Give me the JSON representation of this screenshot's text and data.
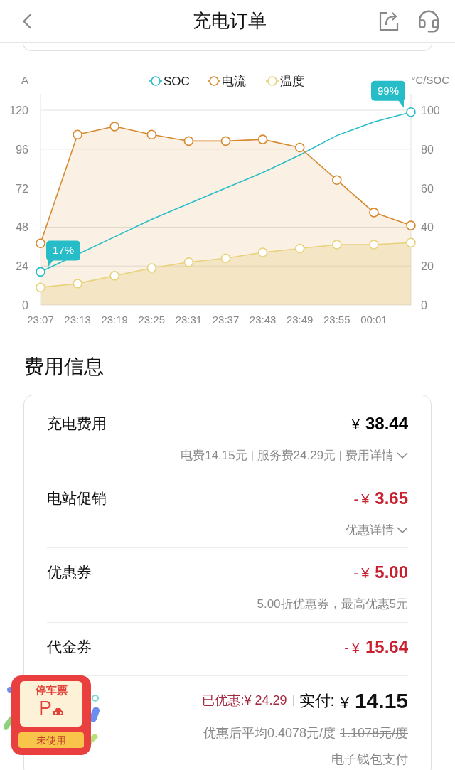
{
  "header": {
    "title": "充电订单"
  },
  "chart": {
    "chart_data": {
      "type": "line",
      "grid": true,
      "legend": "top",
      "ylabel": "A",
      "y2label": "°C/SOC",
      "ylim": [
        0,
        120
      ],
      "yticks": [
        0,
        24,
        48,
        72,
        96,
        120
      ],
      "y2lim": [
        0,
        100
      ],
      "y2ticks": [
        0,
        20,
        40,
        60,
        80,
        100
      ],
      "categories": [
        "23:07",
        "23:13",
        "23:19",
        "23:25",
        "23:31",
        "23:37",
        "23:43",
        "23:49",
        "23:55",
        "00:01",
        null
      ],
      "series": [
        {
          "name": "SOC",
          "color": "#26bdc8",
          "axis": "y2",
          "values": [
            17,
            26,
            35,
            44,
            52,
            60,
            68,
            77,
            87,
            94,
            99
          ]
        },
        {
          "name": "电流",
          "color": "#d68a30",
          "marker": "circle",
          "type": "area",
          "values": [
            38,
            105,
            110,
            105,
            101,
            101,
            102,
            97,
            77,
            57,
            49
          ]
        },
        {
          "name": "温度",
          "color": "#e8d27a",
          "axis": "y2",
          "marker": "circle",
          "type": "area",
          "values": [
            9,
            11,
            15,
            19,
            22,
            24,
            27,
            29,
            31,
            31,
            32
          ]
        }
      ],
      "annotations": [
        "17%",
        "99%"
      ]
    }
  },
  "fees": {
    "title": "费用信息",
    "rows": [
      {
        "kind": "charge",
        "label": "充电费用",
        "sign": "",
        "currency": "¥",
        "amount": "38.44",
        "note": "电费14.15元 | 服务费24.29元 | 费用详情",
        "expandable": true
      },
      {
        "kind": "discount",
        "label": "电站促销",
        "sign": "-",
        "currency": "¥",
        "amount": "3.65",
        "note": "优惠详情",
        "expandable": true
      },
      {
        "kind": "discount",
        "label": "优惠券",
        "sign": "-",
        "currency": "¥",
        "amount": "5.00",
        "note": "5.00折优惠券，最高优惠5元",
        "expandable": false
      },
      {
        "kind": "discount",
        "label": "代金券",
        "sign": "-",
        "currency": "¥",
        "amount": "15.64"
      }
    ],
    "summary": {
      "saved": "已优惠:¥ 24.29",
      "paid_label": "实付:",
      "currency": "¥",
      "paid": "14.15",
      "average": "优惠后平均0.4078元/度",
      "original_average": "1.1078元/度",
      "payment": "电子钱包支付"
    }
  },
  "parking_ticket": {
    "title": "停车票",
    "letter": "P",
    "status": "未使用"
  }
}
